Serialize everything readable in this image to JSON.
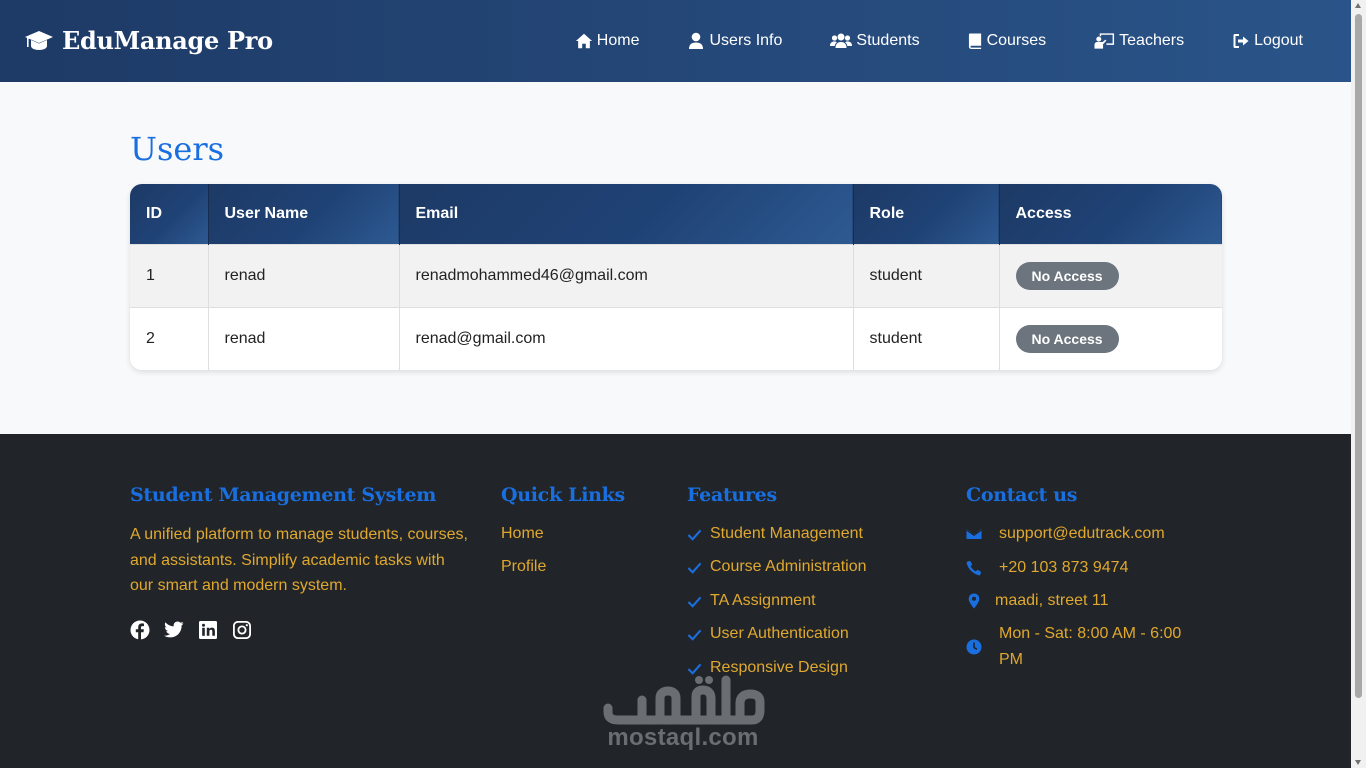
{
  "navbar": {
    "brand": "EduManage Pro",
    "links": [
      {
        "label": "Home",
        "icon": "home-icon"
      },
      {
        "label": "Users Info",
        "icon": "user-icon"
      },
      {
        "label": "Students",
        "icon": "users-icon"
      },
      {
        "label": "Courses",
        "icon": "book-icon"
      },
      {
        "label": "Teachers",
        "icon": "teacher-icon"
      },
      {
        "label": "Logout",
        "icon": "logout-icon"
      }
    ]
  },
  "main": {
    "title": "Users",
    "table": {
      "headers": [
        "ID",
        "User Name",
        "Email",
        "Role",
        "Access"
      ],
      "rows": [
        {
          "id": "1",
          "name": "renad",
          "email": "renadmohammed46@gmail.com",
          "role": "student",
          "access": "No Access"
        },
        {
          "id": "2",
          "name": "renad",
          "email": "renad@gmail.com",
          "role": "student",
          "access": "No Access"
        }
      ]
    }
  },
  "footer": {
    "about": {
      "title": "Student Management System",
      "text": "A unified platform to manage students, courses, and assistants. Simplify academic tasks with our smart and modern system.",
      "social": [
        "facebook-icon",
        "twitter-icon",
        "linkedin-icon",
        "instagram-icon"
      ]
    },
    "quick_links": {
      "title": "Quick Links",
      "items": [
        "Home",
        "Profile"
      ]
    },
    "features": {
      "title": "Features",
      "items": [
        "Student Management",
        "Course Administration",
        "TA Assignment",
        "User Authentication",
        "Responsive Design"
      ]
    },
    "contact": {
      "title": "Contact us",
      "email": "support@edutrack.com",
      "phone": "+20 103 873 9474",
      "address": "maadi, street 11",
      "hours_line1": "Mon - Sat: 8:00 AM - 6:00",
      "hours_line2": "PM"
    }
  },
  "watermark": {
    "arabic": "مستقل",
    "latin": "mostaql.com"
  },
  "colors": {
    "nav_start": "#1e3a66",
    "nav_end": "#2a5489",
    "accent_blue": "#1a6fe0",
    "footer_bg": "#212529",
    "footer_text": "#e0a82e",
    "badge": "#6c757d"
  }
}
